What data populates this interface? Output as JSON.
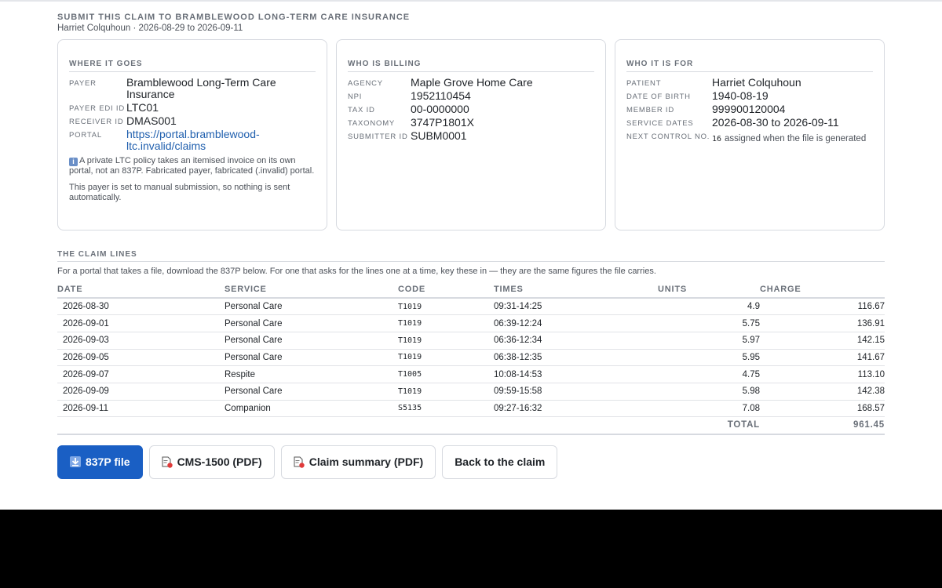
{
  "header": {
    "title": "SUBMIT THIS CLAIM TO BRAMBLEWOOD LONG-TERM CARE INSURANCE",
    "subtitle": "Harriet Colquhoun · 2026-08-29 to 2026-09-11"
  },
  "where": {
    "heading": "WHERE IT GOES",
    "payer_label": "PAYER",
    "payer": "Bramblewood Long-Term Care Insurance",
    "edi_label": "PAYER EDI ID",
    "edi": "LTC01",
    "receiver_label": "RECEIVER ID",
    "receiver": "DMAS001",
    "portal_label": "PORTAL",
    "portal": "https://portal.bramblewood-ltc.invalid/claims",
    "note1": "A private LTC policy takes an itemised invoice on its own portal, not an 837P. Fabricated payer, fabricated (.invalid) portal.",
    "note2": "This payer is set to manual submission, so nothing is sent automatically."
  },
  "billing": {
    "heading": "WHO IS BILLING",
    "agency_label": "AGENCY",
    "agency": "Maple Grove Home Care",
    "npi_label": "NPI",
    "npi": "1952110454",
    "tax_label": "TAX ID",
    "tax": "00-0000000",
    "taxonomy_label": "TAXONOMY",
    "taxonomy": "3747P1801X",
    "submitter_label": "SUBMITTER ID",
    "submitter": "SUBM0001"
  },
  "patient": {
    "heading": "WHO IT IS FOR",
    "patient_label": "PATIENT",
    "patient": "Harriet Colquhoun",
    "dob_label": "DATE OF BIRTH",
    "dob": "1940-08-19",
    "member_label": "MEMBER ID",
    "member": "999900120004",
    "dates_label": "SERVICE DATES",
    "dates": "2026-08-30 to 2026-09-11",
    "control_label": "NEXT CONTROL NO.",
    "control": "16",
    "control_note": "assigned when the file is generated"
  },
  "lines": {
    "heading": "THE CLAIM LINES",
    "intro": "For a portal that takes a file, download the 837P below. For one that asks for the lines one at a time, key these in — they are the same figures the file carries.",
    "columns": [
      "DATE",
      "SERVICE",
      "CODE",
      "TIMES",
      "UNITS",
      "CHARGE"
    ],
    "rows": [
      {
        "date": "2026-08-30",
        "service": "Personal Care",
        "code": "T1019",
        "times": "09:31-14:25",
        "units": "4.9",
        "charge": "116.67"
      },
      {
        "date": "2026-09-01",
        "service": "Personal Care",
        "code": "T1019",
        "times": "06:39-12:24",
        "units": "5.75",
        "charge": "136.91"
      },
      {
        "date": "2026-09-03",
        "service": "Personal Care",
        "code": "T1019",
        "times": "06:36-12:34",
        "units": "5.97",
        "charge": "142.15"
      },
      {
        "date": "2026-09-05",
        "service": "Personal Care",
        "code": "T1019",
        "times": "06:38-12:35",
        "units": "5.95",
        "charge": "141.67"
      },
      {
        "date": "2026-09-07",
        "service": "Respite",
        "code": "T1005",
        "times": "10:08-14:53",
        "units": "4.75",
        "charge": "113.10"
      },
      {
        "date": "2026-09-09",
        "service": "Personal Care",
        "code": "T1019",
        "times": "09:59-15:58",
        "units": "5.98",
        "charge": "142.38"
      },
      {
        "date": "2026-09-11",
        "service": "Companion",
        "code": "S5135",
        "times": "09:27-16:32",
        "units": "7.08",
        "charge": "168.57"
      }
    ],
    "total_label": "TOTAL",
    "total": "961.45"
  },
  "actions": {
    "file": "837P file",
    "cms": "CMS-1500 (PDF)",
    "summary": "Claim summary (PDF)",
    "back": "Back to the claim"
  },
  "colors": {
    "primary": "#1a5fc4",
    "link": "#1f5fae",
    "pdf_icon_badge": "#e03a3a"
  }
}
